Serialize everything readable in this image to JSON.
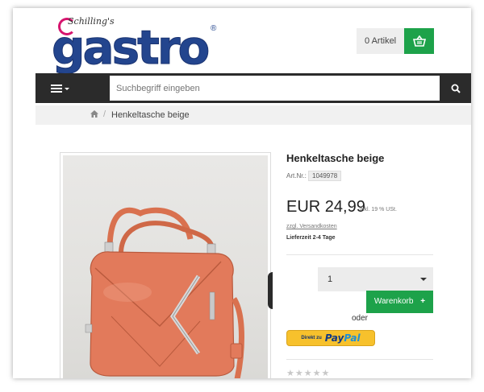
{
  "header": {
    "logo_script": "Schilling's",
    "logo_word": "gastro",
    "logo_reg": "®",
    "cart_label": "0 Artikel",
    "cart_icon": "basket-icon"
  },
  "search": {
    "placeholder": "Suchbegriff eingeben",
    "menu_icon": "hamburger-menu-icon",
    "search_icon": "search-icon"
  },
  "breadcrumb": {
    "home_icon": "home-icon",
    "separator": "/",
    "current": "Henkeltasche beige"
  },
  "product": {
    "title": "Henkeltasche beige",
    "art_label": "Art.Nr.:",
    "art_number": "1049978",
    "price": "EUR 24,99",
    "tax_note": "inkl. 19 % USt.",
    "shipping_link": "zzgl. Versandkosten",
    "delivery": "Lieferzeit 2-4 Tage",
    "quantity": "1",
    "add_to_cart": "Warenkorb",
    "or_label": "oder",
    "paypal_prefix": "Direkt zu",
    "paypal_pay": "Pay",
    "paypal_pal": "Pal",
    "rating": "★★★★★",
    "image_alt": "Henkeltasche beige"
  },
  "colors": {
    "brand_blue": "#23458e",
    "accent_green": "#1da24a",
    "nav_dark": "#2b2b2b",
    "bag_color": "#e27a5b"
  }
}
